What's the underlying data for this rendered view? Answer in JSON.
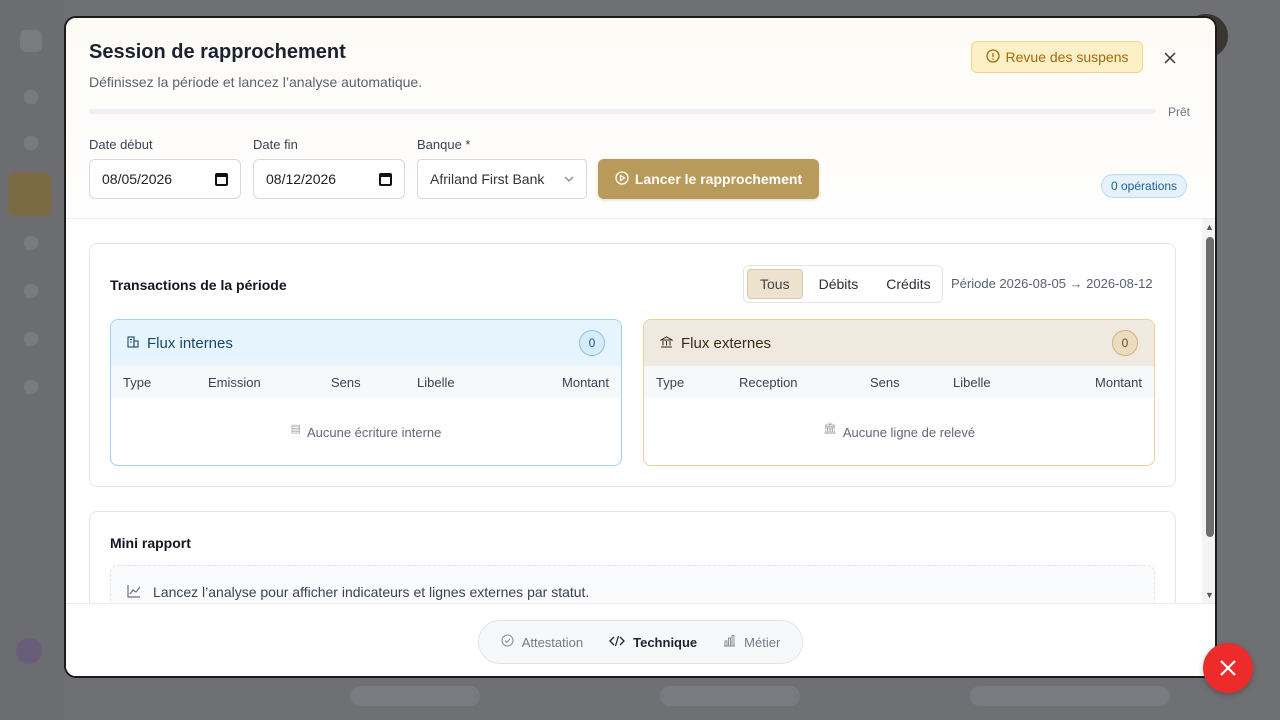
{
  "modal": {
    "title": "Session de rapprochement",
    "subtitle": "Définissez la période et lancez l’analyse automatique.",
    "suspense_button": "Revue des suspens",
    "progress_label": "Prêt",
    "progress_fraction": 0
  },
  "form": {
    "start_label": "Date début",
    "start_value": "08/05/2026",
    "end_label": "Date fin",
    "end_value": "08/12/2026",
    "bank_label": "Banque *",
    "bank_value": "Afriland First Bank",
    "launch_button": "Lancer le rapprochement",
    "operations_badge": "0 opérations"
  },
  "transactions": {
    "title": "Transactions de la période",
    "filters": [
      "Tous",
      "Débits",
      "Crédits"
    ],
    "active_filter": "Tous",
    "period": "Période 2026-08-05 → 2026-08-12",
    "internal": {
      "title": "Flux internes",
      "count": "0",
      "columns": [
        "Type",
        "Emission",
        "Sens",
        "Libelle",
        "Montant"
      ],
      "empty": "Aucune écriture interne"
    },
    "external": {
      "title": "Flux externes",
      "count": "0",
      "columns": [
        "Type",
        "Reception",
        "Sens",
        "Libelle",
        "Montant"
      ],
      "empty": "Aucune ligne de relevé"
    }
  },
  "report": {
    "title": "Mini rapport",
    "info": "Lancez l’analyse pour afficher indicateurs et lignes externes par statut."
  },
  "footer": {
    "tabs": [
      "Attestation",
      "Technique",
      "Métier"
    ],
    "active_tab": "Technique"
  },
  "colors": {
    "accent": "#b89a5a",
    "fab": "#ee2b2b"
  }
}
